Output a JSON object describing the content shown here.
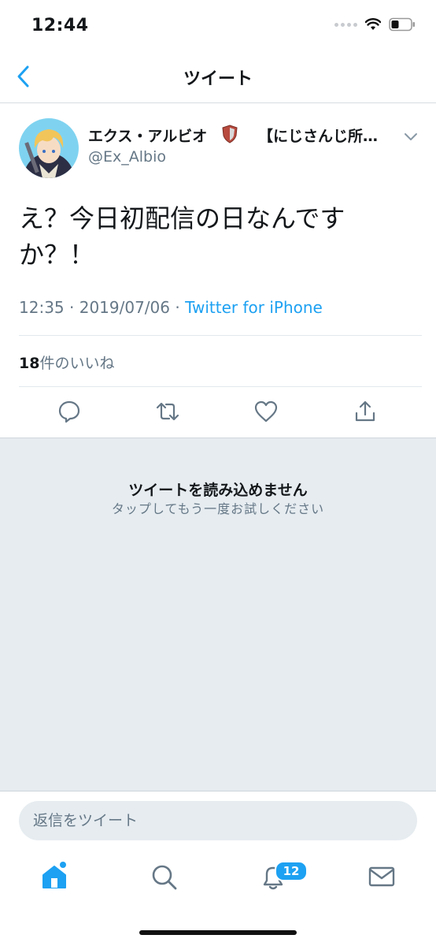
{
  "status_bar": {
    "time": "12:44"
  },
  "nav": {
    "title": "ツイート",
    "back_icon": "chevron-left-icon"
  },
  "tweet": {
    "display_name": "エクス・アルビオ",
    "affiliation": "【にじさんじ所…",
    "handle": "@Ex_Albio",
    "text": "え？今日初配信の日なんですか？！",
    "time": "12:35",
    "separator": "·",
    "date": "2019/07/06",
    "source": "Twitter for iPhone",
    "like_count": "18",
    "like_label": "件のいいね"
  },
  "error": {
    "title": "ツイートを読み込めません",
    "subtitle": "タップしてもう一度お試しください"
  },
  "reply": {
    "placeholder": "返信をツイート"
  },
  "tabbar": {
    "notification_badge": "12"
  },
  "colors": {
    "accent": "#1da1f2",
    "muted": "#657786",
    "panel": "#e6ecf0"
  }
}
